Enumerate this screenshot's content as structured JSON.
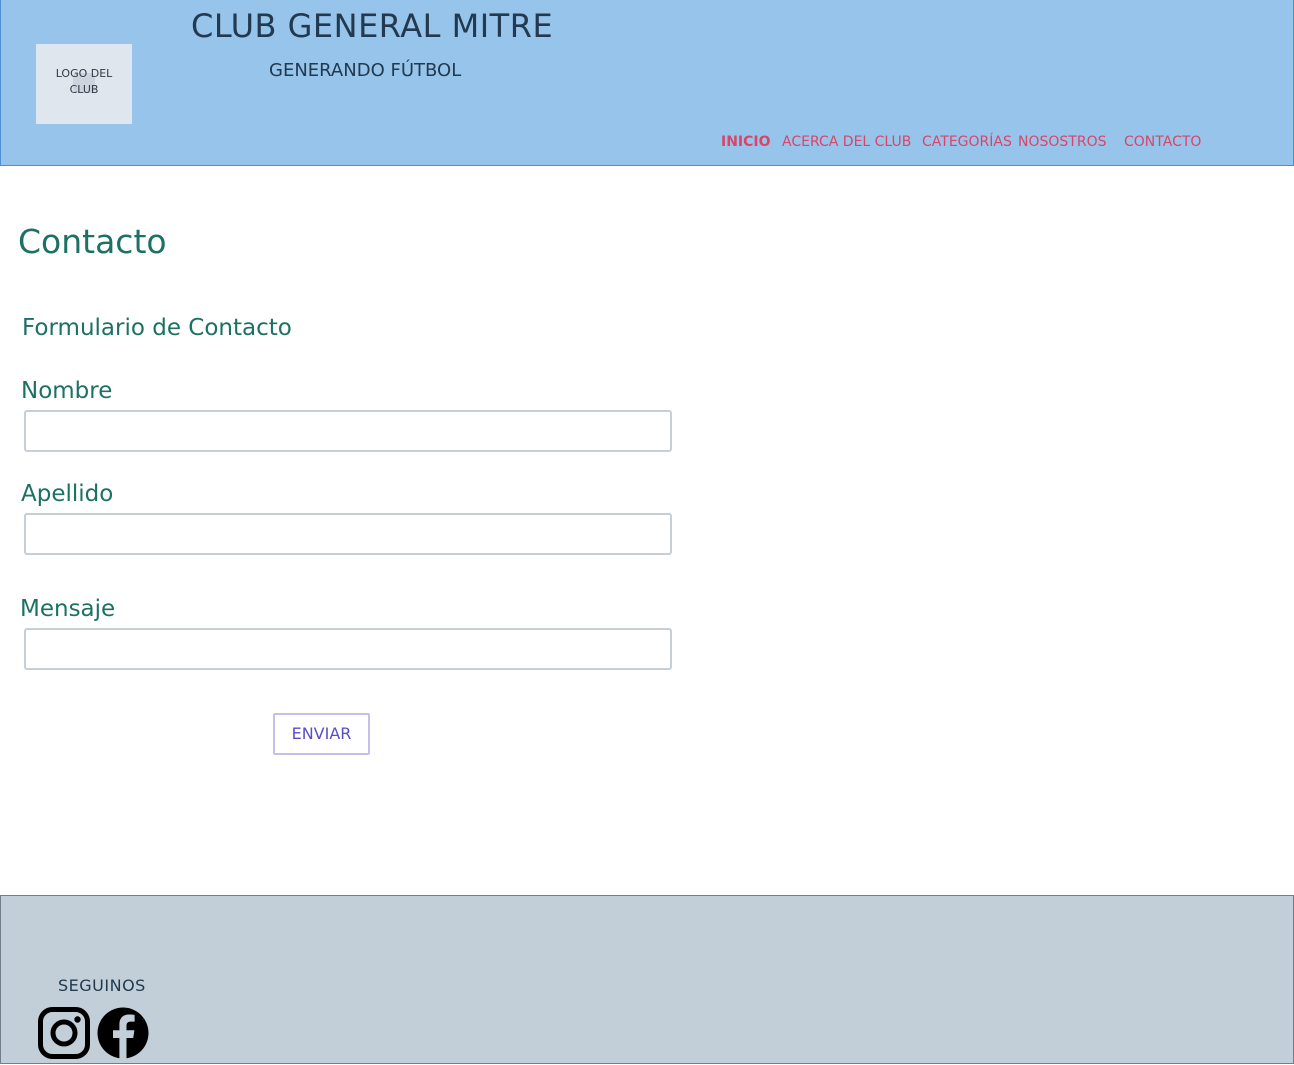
{
  "header": {
    "logo_alt": "LOGO DEL CLUB",
    "title": "CLUB GENERAL MITRE",
    "subtitle": "GENERANDO FÚTBOL",
    "background_color": "#97c4eb",
    "nav": [
      {
        "label": "INICIO",
        "active": true
      },
      {
        "label": "ACERCA DEL CLUB",
        "active": false
      },
      {
        "label": "CATEGORÍAS",
        "active": false
      },
      {
        "label": "NOSOSTROS",
        "active": false
      },
      {
        "label": "CONTACTO",
        "active": false
      }
    ],
    "nav_color": "#d94569"
  },
  "main": {
    "page_title": "Contacto",
    "form": {
      "title": "Formulario de Contacto",
      "fields": [
        {
          "label": "Nombre",
          "value": "",
          "placeholder": ""
        },
        {
          "label": "Apellido",
          "value": "",
          "placeholder": ""
        },
        {
          "label": "Mensaje",
          "value": "",
          "placeholder": ""
        }
      ],
      "submit_label": "ENVIAR"
    },
    "accent_color": "#1d7164"
  },
  "footer": {
    "follow_label": "SEGUINOS",
    "social": [
      {
        "icon": "instagram-icon"
      },
      {
        "icon": "facebook-icon"
      }
    ],
    "background_color": "#c2cfd8"
  }
}
